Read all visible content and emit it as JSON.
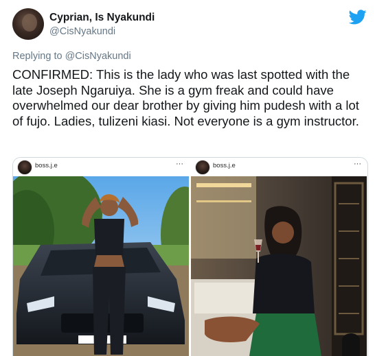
{
  "tweet": {
    "author_name": "Cyprian, Is Nyakundi",
    "author_handle": "@CisNyakundi",
    "reply_prefix": "Replying to ",
    "reply_handle": "@CisNyakundi",
    "text": "CONFIRMED: This is the lady who was last spotted with the late Joseph Ngaruiya. She is a gym freak and could have overwhelmed our dear brother by giving him pudesh with a lot of fujo. Ladies, tulizeni kiasi. Not everyone is a gym instructor."
  },
  "media": {
    "posts": [
      {
        "username": "boss.j.e",
        "more": "···",
        "photo_icon": "photo-woman-car"
      },
      {
        "username": "boss.j.e",
        "more": "···",
        "photo_icon": "photo-woman-wine"
      }
    ]
  },
  "icons": {
    "brand": "twitter-bird-icon"
  },
  "colors": {
    "brand": "#1da1f2",
    "secondary_text": "#657786",
    "text": "#14171a"
  }
}
